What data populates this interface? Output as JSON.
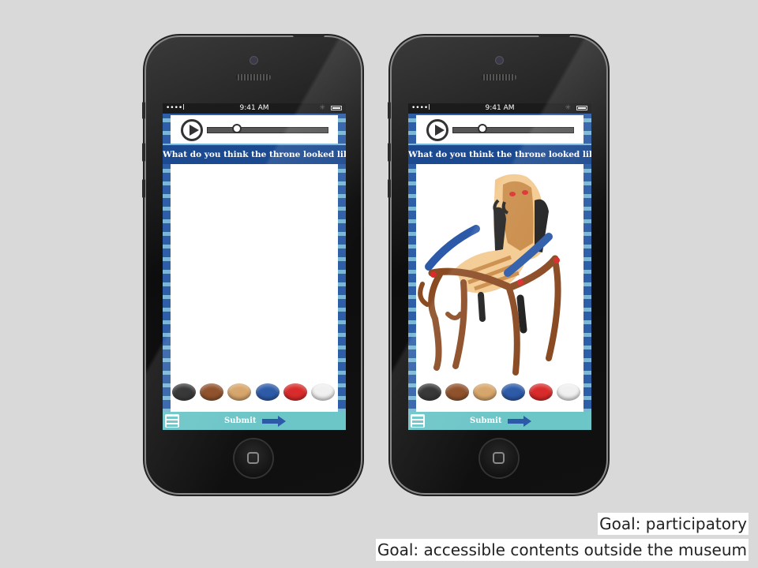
{
  "status_bar": {
    "time": "9:41 AM",
    "signal": "••••l"
  },
  "question": "What do you think the throne looked like?",
  "submit_label": "Submit",
  "palette": [
    "#2a2a2a",
    "#8a4a22",
    "#d6a468",
    "#2c5aa8",
    "#d92b2b",
    "#f0f0f0"
  ],
  "goals": {
    "goal1": "Goal: participatory",
    "goal2": "Goal: accessible contents outside the museum"
  },
  "audio_progress": 0.25
}
